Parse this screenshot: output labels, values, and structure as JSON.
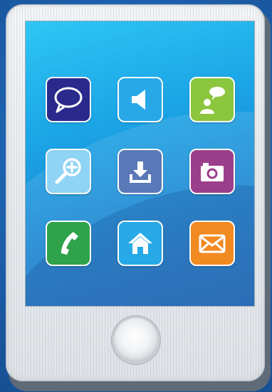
{
  "device": {
    "type": "tablet",
    "screen_gradient": [
      "#2fc6f4",
      "#1d6fc0"
    ],
    "frame_color": "#eceff2",
    "background_color": "#1b5fad"
  },
  "apps": [
    {
      "icon": "speech-bubble-icon",
      "color": "#2a2a8c"
    },
    {
      "icon": "speaker-icon",
      "color": "#29a8e8"
    },
    {
      "icon": "chat-user-icon",
      "color": "#8cc63e"
    },
    {
      "icon": "zoom-in-icon",
      "color": "#8fd3f5"
    },
    {
      "icon": "download-icon",
      "color": "#5b79b8"
    },
    {
      "icon": "camera-icon",
      "color": "#9b3f8a"
    },
    {
      "icon": "phone-icon",
      "color": "#2fa24a"
    },
    {
      "icon": "home-icon",
      "color": "#26a9e6"
    },
    {
      "icon": "mail-icon",
      "color": "#f28a22"
    }
  ],
  "home_button": {
    "icon": "home-button"
  }
}
